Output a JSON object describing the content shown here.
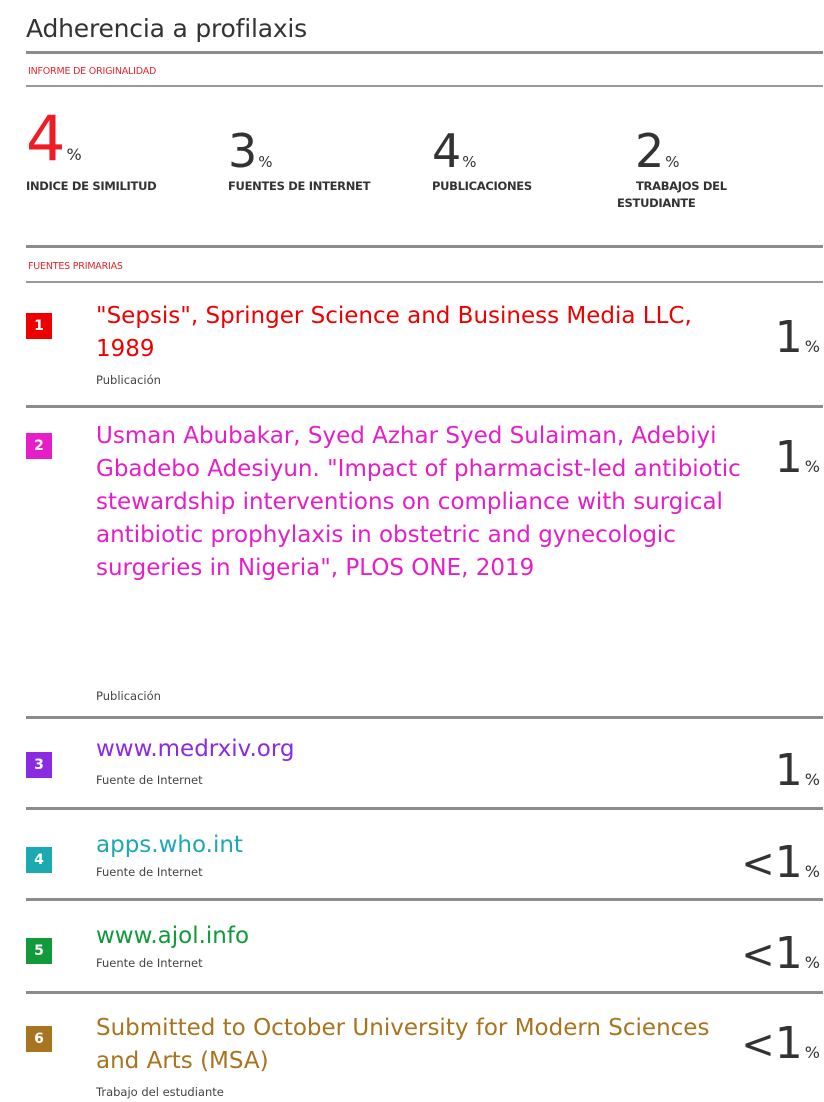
{
  "document_title": "Adherencia a profilaxis",
  "report_label": "INFORME DE ORIGINALIDAD",
  "stats": [
    {
      "value": "4",
      "unit": "%",
      "label": "INDICE DE SIMILITUD"
    },
    {
      "value": "3",
      "unit": "%",
      "label": "FUENTES DE INTERNET"
    },
    {
      "value": "4",
      "unit": "%",
      "label": "PUBLICACIONES"
    },
    {
      "value": "2",
      "unit": "%",
      "label_line1": "TRABAJOS DEL",
      "label_line2": "ESTUDIANTE"
    }
  ],
  "primary_label": "FUENTES PRIMARIAS",
  "sources": [
    {
      "rank": "1",
      "color": "#ee0000",
      "title": "\"Sepsis\", Springer Science and Business Media LLC, 1989",
      "type": "Publicación",
      "prefix": "",
      "percent": "1",
      "unit": "%"
    },
    {
      "rank": "2",
      "color": "#e61ec8",
      "title": "Usman Abubakar, Syed Azhar Syed Sulaiman, Adebiyi Gbadebo Adesiyun. \"Impact of pharmacist-led antibiotic stewardship interventions on compliance with surgical antibiotic prophylaxis in obstetric and gynecologic surgeries in Nigeria\", PLOS ONE, 2019",
      "type": "Publicación",
      "prefix": "",
      "percent": "1",
      "unit": "%"
    },
    {
      "rank": "3",
      "color": "#8a2be2",
      "title": "www.medrxiv.org",
      "type": "Fuente de Internet",
      "prefix": "",
      "percent": "1",
      "unit": "%"
    },
    {
      "rank": "4",
      "color": "#1ca9b2",
      "title": "apps.who.int",
      "type": "Fuente de Internet",
      "prefix": "<",
      "percent": "1",
      "unit": "%"
    },
    {
      "rank": "5",
      "color": "#119a3a",
      "title": "www.ajol.info",
      "type": "Fuente de Internet",
      "prefix": "<",
      "percent": "1",
      "unit": "%"
    },
    {
      "rank": "6",
      "color": "#a8741f",
      "title": "Submitted to October University for Modern Sciences and Arts (MSA)",
      "type": "Trabajo del estudiante",
      "prefix": "<",
      "percent": "1",
      "unit": "%"
    }
  ]
}
